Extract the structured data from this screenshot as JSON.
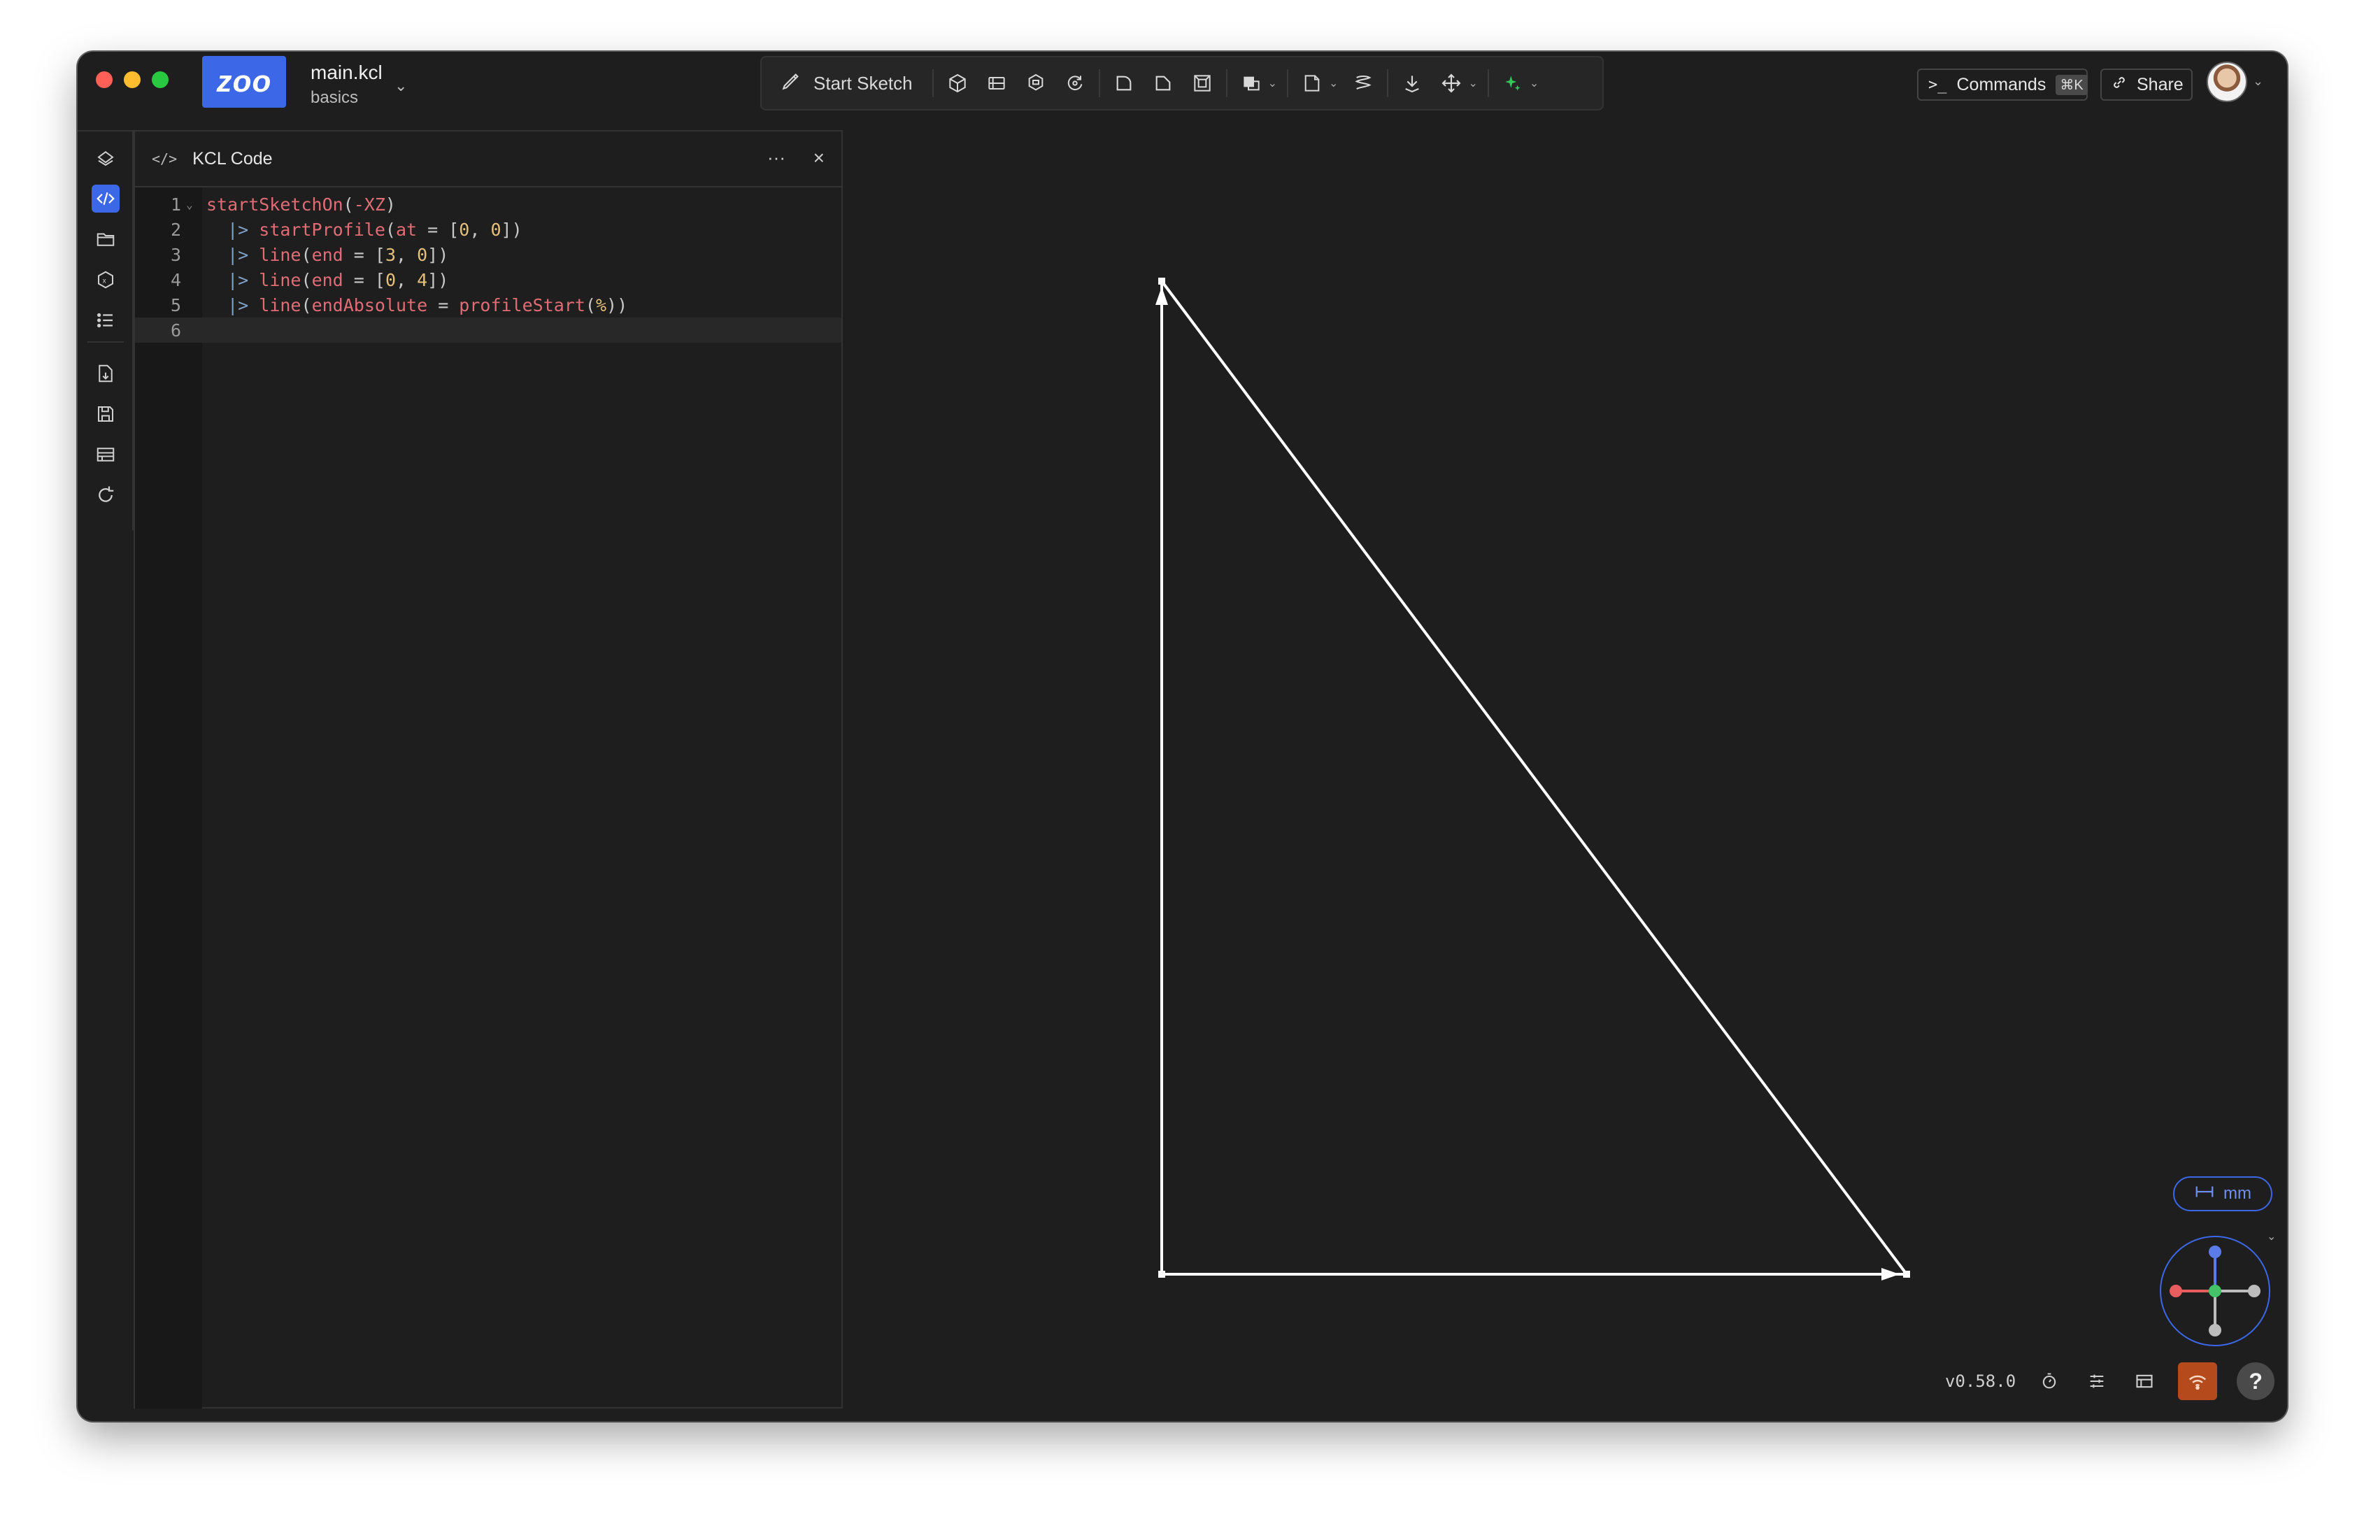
{
  "window": {
    "file_name": "main.kcl",
    "project_name": "basics",
    "logo_text": "zoo",
    "brand_color": "#3c68e8"
  },
  "toolbar": {
    "start_sketch_label": "Start Sketch",
    "icons": [
      "extrude-icon",
      "sweep-icon",
      "loft-icon",
      "revolve-icon",
      "fillet-icon",
      "chamfer-icon",
      "shell-icon",
      "boolean-icon",
      "plane-icon",
      "helix-icon",
      "insert-icon",
      "transform-icon",
      "text-to-cad-icon"
    ]
  },
  "header_actions": {
    "commands_label": "Commands",
    "commands_shortcut": "⌘K",
    "share_label": "Share"
  },
  "rail": {
    "items": [
      "feature-tree-icon",
      "code-icon",
      "files-icon",
      "variables-icon",
      "logs-icon",
      "export-icon",
      "save-icon",
      "manage-icon",
      "refresh-icon"
    ],
    "active": "code-icon"
  },
  "panel": {
    "title": "KCL Code",
    "menu_label": "···",
    "close_label": "×"
  },
  "code_lines": [
    {
      "num": "1",
      "fold": "⌄"
    },
    {
      "num": "2",
      "fold": ""
    },
    {
      "num": "3",
      "fold": ""
    },
    {
      "num": "4",
      "fold": ""
    },
    {
      "num": "5",
      "fold": ""
    },
    {
      "num": "6",
      "fold": ""
    }
  ],
  "code": {
    "l1": {
      "fn": "startSketchOn",
      "open": "(",
      "arg": "-XZ",
      "close": ")"
    },
    "l2": {
      "pipe": "|>",
      "fn": "startProfile",
      "open": "(",
      "kw": "at",
      "eq": " = ",
      "lb": "[",
      "a": "0",
      "comma": ", ",
      "b": "0",
      "rb": "]",
      "close": ")"
    },
    "l3": {
      "pipe": "|>",
      "fn": "line",
      "open": "(",
      "kw": "end",
      "eq": " = ",
      "lb": "[",
      "a": "3",
      "comma": ", ",
      "b": "0",
      "rb": "]",
      "close": ")"
    },
    "l4": {
      "pipe": "|>",
      "fn": "line",
      "open": "(",
      "kw": "end",
      "eq": " = ",
      "lb": "[",
      "a": "0",
      "comma": ", ",
      "b": "4",
      "rb": "]",
      "close": ")"
    },
    "l5": {
      "pipe": "|>",
      "fn": "line",
      "open": "(",
      "kw": "endAbsolute",
      "eq": " = ",
      "fn2": "profileStart",
      "open2": "(",
      "pct": "%",
      "close2": "))"
    }
  },
  "sketch": {
    "profile": [
      [
        0,
        0
      ],
      [
        3,
        0
      ],
      [
        0,
        4
      ]
    ],
    "stroke_color": "#ffffff"
  },
  "viewport": {
    "units_label": "mm",
    "gizmo_colors": {
      "x": "#e85d5d",
      "y": "#44c267",
      "z": "#5b7ce8",
      "neg": "#bdbdbd"
    }
  },
  "status": {
    "version": "v0.58.0",
    "network_color": "#b54a1c",
    "help_label": "?"
  }
}
